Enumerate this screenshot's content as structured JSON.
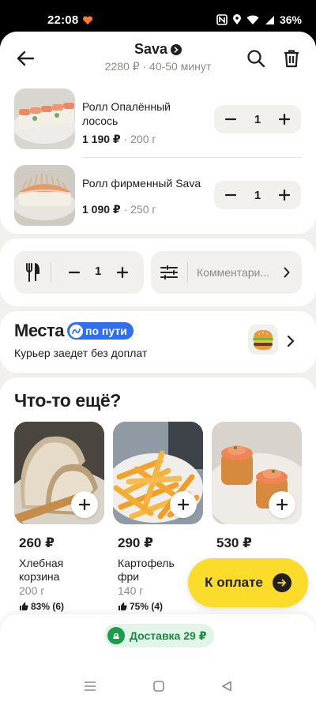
{
  "status_bar": {
    "time": "22:08",
    "battery": "36%"
  },
  "header": {
    "restaurant": "Sava",
    "subtitle": "2280 ₽ · 40-50 минут"
  },
  "cart_items": [
    {
      "name": "Ролл Опалённый лосось",
      "price": "1 190 ₽",
      "weight": "200 г",
      "quantity": "1"
    },
    {
      "name": "Ролл фирменный Sava",
      "price": "1 090 ₽",
      "weight": "250 г",
      "quantity": "1"
    }
  ],
  "options": {
    "cutlery_count": "1",
    "comment_placeholder": "Комментари..."
  },
  "places": {
    "brand": "Места",
    "badge": "по пути",
    "subtitle": "Курьер заедет без доплат"
  },
  "more": {
    "title": "Что-то ещё?",
    "products": [
      {
        "price": "260 ₽",
        "name_line1": "Хлебная",
        "name_line2": "корзина",
        "weight": "200 г",
        "rating": "83% (6)"
      },
      {
        "price": "290 ₽",
        "name_line1": "Картофель",
        "name_line2": "фри",
        "weight": "140 г",
        "rating": "75% (4)"
      },
      {
        "price": "530 ₽",
        "name_line1": "",
        "name_line2": "",
        "weight": "",
        "rating": ""
      }
    ]
  },
  "pay_button": {
    "label": "К оплате"
  },
  "delivery": {
    "label": "Доставка 29 ₽"
  },
  "colors": {
    "accent": "#fcdc2a",
    "delivery_green": "#1a9c4a",
    "places_blue": "#2f6ff0"
  }
}
